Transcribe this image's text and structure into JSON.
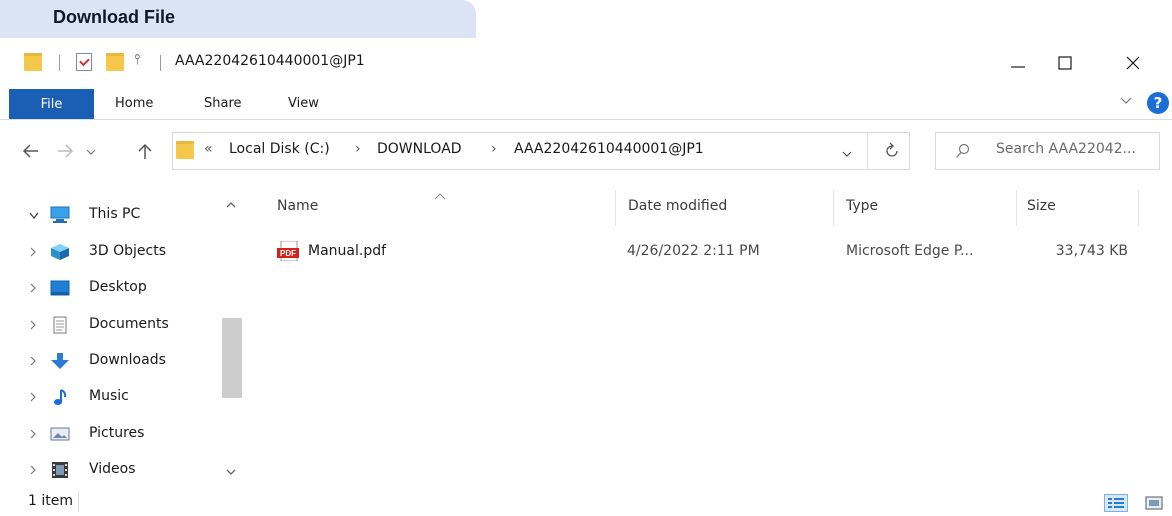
{
  "caption": "Download File",
  "window": {
    "title": "AAA22042610440001@JP1",
    "qat_dropdown": "⫯"
  },
  "ribbon": {
    "tabs": [
      "File",
      "Home",
      "Share",
      "View"
    ]
  },
  "address": {
    "overflow": "«",
    "crumbs": [
      "Local Disk (C:)",
      "DOWNLOAD",
      "AAA22042610440001@JP1"
    ],
    "separator": "›"
  },
  "search": {
    "placeholder": "Search AAA22042..."
  },
  "nav": {
    "items": [
      {
        "label": "This PC",
        "icon": "pc-icon",
        "expanded": true
      },
      {
        "label": "3D Objects",
        "icon": "cube-icon"
      },
      {
        "label": "Desktop",
        "icon": "desktop-icon"
      },
      {
        "label": "Documents",
        "icon": "document-icon"
      },
      {
        "label": "Downloads",
        "icon": "download-arrow-icon"
      },
      {
        "label": "Music",
        "icon": "music-note-icon"
      },
      {
        "label": "Pictures",
        "icon": "picture-icon"
      },
      {
        "label": "Videos",
        "icon": "film-icon"
      }
    ]
  },
  "columns": {
    "name": "Name",
    "date": "Date modified",
    "type": "Type",
    "size": "Size"
  },
  "files": [
    {
      "name": "Manual.pdf",
      "date": "4/26/2022 2:11 PM",
      "type": "Microsoft Edge P...",
      "size": "33,743 KB",
      "icon": "pdf-icon"
    }
  ],
  "status": {
    "count": "1 item"
  },
  "colors": {
    "file_tab": "#1a5fb4",
    "folder": "#f5c84c",
    "help": "#1a6fd6",
    "caption_bg": "#dbe4f5"
  }
}
